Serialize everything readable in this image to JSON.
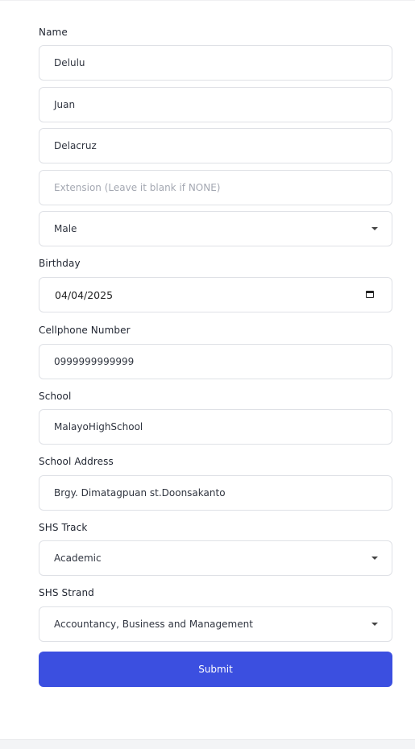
{
  "form": {
    "name_label": "Name",
    "first_name": "Delulu",
    "middle_name": "Juan",
    "last_name": "Delacruz",
    "extension_placeholder": "Extension (Leave it blank if NONE)",
    "gender_selected": "Male",
    "birthday_label": "Birthday",
    "birthday_value": "04/04/2025",
    "cellphone_label": "Cellphone Number",
    "cellphone_value": "0999999999999",
    "school_label": "School",
    "school_value": "MalayoHighSchool",
    "school_address_label": "School Address",
    "school_address_value": "Brgy. Dimatagpuan st.Doonsakanto",
    "shs_track_label": "SHS Track",
    "shs_track_selected": "Academic",
    "shs_strand_label": "SHS Strand",
    "shs_strand_selected": "Accountancy, Business and Management",
    "submit_label": "Submit"
  },
  "colors": {
    "accent": "#3b4fe0",
    "border": "#dfe1e6",
    "placeholder": "#a4a8b2"
  },
  "icons": [
    "chevron-down-icon",
    "calendar-icon"
  ]
}
